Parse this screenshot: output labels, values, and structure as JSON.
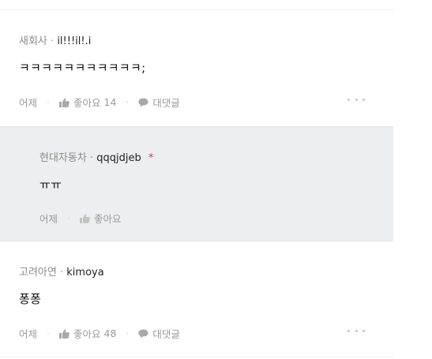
{
  "comments": [
    {
      "company": "새회사",
      "separator": "·",
      "username": "il!!!il!.i",
      "text": "ㅋㅋㅋㅋㅋㅋㅋㅋㅋㅋㅋ;",
      "time": "어제",
      "like_label": "좋아요",
      "like_count": "14",
      "reply_label": "대댓글"
    },
    {
      "company": "현대자동차",
      "separator": "·",
      "username": "qqqjdjeb",
      "badge": "*",
      "text": "ㅠㅠ",
      "time": "어제",
      "like_label": "좋아요"
    },
    {
      "company": "고려아연",
      "separator": "·",
      "username": "kimoya",
      "text": "퐁퐁",
      "time": "어제",
      "like_label": "좋아요",
      "like_count": "48",
      "reply_label": "대댓글"
    }
  ],
  "colors": {
    "reply_background": "#eceef1",
    "badge": "#e0383e",
    "muted_text": "#8a8a8a"
  },
  "icons": {
    "like": "thumbs-up-icon",
    "reply": "speech-bubble-icon",
    "more": "more-dots-icon"
  }
}
